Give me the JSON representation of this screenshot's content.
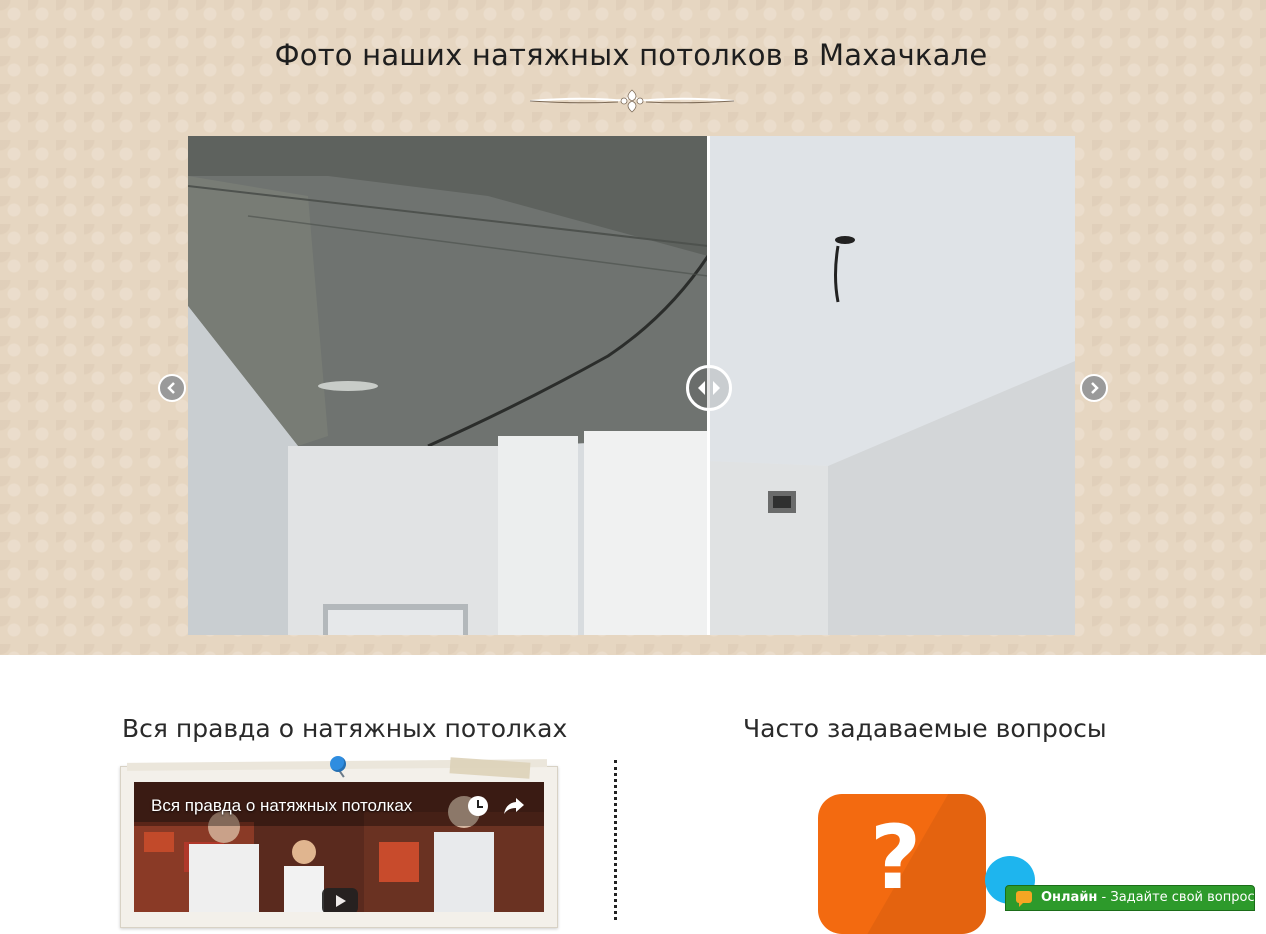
{
  "gallery": {
    "title": "Фото наших натяжных потолков в Махачкале"
  },
  "video_section": {
    "title": "Вся правда о натяжных потолках",
    "video_title": "Вся правда о натяжных потолках"
  },
  "faq_section": {
    "title": "Часто задаваемые вопросы",
    "icon_symbol": "?"
  },
  "online_chat": {
    "status": "Онлайн",
    "text": " - Задайте свой вопрос"
  },
  "colors": {
    "pattern_bg": "#e6d6c1",
    "faq_orange": "#f36a10",
    "faq_bubble": "#1eb5ee",
    "online_green": "#2d9a2b"
  }
}
